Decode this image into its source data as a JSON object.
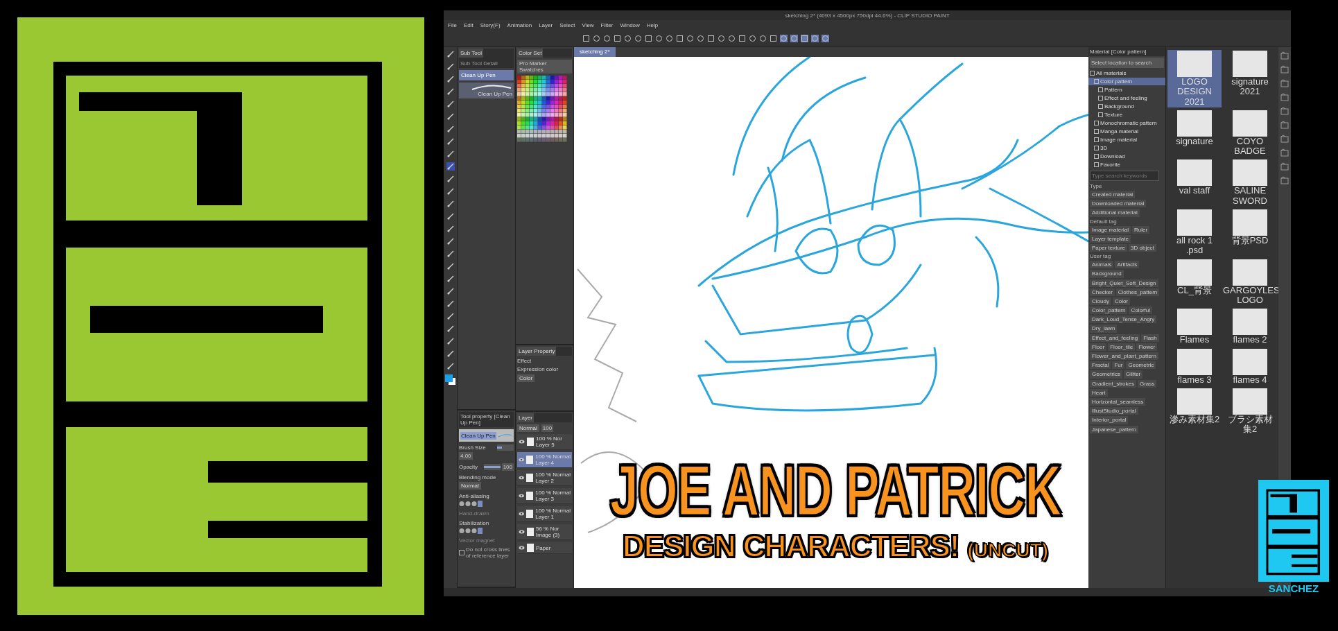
{
  "app": {
    "title": "sketching 2* (4093 x 4500px 750dpi 44.6%) - CLIP STUDIO PAINT",
    "menu": [
      "File",
      "Edit",
      "Story(F)",
      "Animation",
      "Layer",
      "Select",
      "View",
      "Filter",
      "Window",
      "Help"
    ],
    "sub_tool": {
      "tabs": [
        {
          "label": "Sub Tool",
          "selected": true
        },
        {
          "label": "Sub Tool Detail",
          "selected": false
        }
      ],
      "items": [
        {
          "label": "Clean Up Pen",
          "selected": true
        }
      ],
      "preview_label": "Clean Up Pen"
    },
    "color_set": {
      "tab": "Color Set",
      "dropdown": "Pro Marker Swatches"
    },
    "canvas_tab": "sketching 2*",
    "layer_property": {
      "tab": "Layer Property",
      "effect_label": "Effect",
      "expression_label": "Expression color",
      "expression_value": "Color"
    },
    "layers": {
      "tab": "Layer",
      "blend": "Normal",
      "opacity": "100",
      "items": [
        {
          "mode": "100 % Nor",
          "name": "Layer 5",
          "selected": false
        },
        {
          "mode": "100 % Normal",
          "name": "Layer 4",
          "selected": true
        },
        {
          "mode": "100 % Normal",
          "name": "Layer 2",
          "selected": false
        },
        {
          "mode": "100 % Normal",
          "name": "Layer 3",
          "selected": false
        },
        {
          "mode": "100 % Normal",
          "name": "Layer 1",
          "selected": false
        },
        {
          "mode": "56 % Nor",
          "name": "Image (3)",
          "selected": false
        },
        {
          "name": "Paper",
          "selected": false
        }
      ]
    },
    "tool_property": {
      "title": "Tool property [Clean Up Pen]",
      "preview_label": "Clean Up Pen",
      "rows": [
        {
          "kind": "slider",
          "label": "Brush Size",
          "value": "4.00",
          "level": 0.3
        },
        {
          "kind": "slider",
          "label": "Opacity",
          "value": "100",
          "level": 1
        },
        {
          "kind": "dropdown",
          "label": "Blending mode",
          "value": "Normal"
        },
        {
          "kind": "choice",
          "label": "Anti-aliasing"
        },
        {
          "kind": "disabled",
          "label": "Hand-drawn"
        },
        {
          "kind": "choice",
          "label": "Stabilization"
        },
        {
          "kind": "disabled",
          "label": "Vector magnet"
        }
      ],
      "checkbox": {
        "label": "Do not cross lines of reference layer",
        "checked": false
      }
    },
    "materials": {
      "header": "Material [Color pattern]",
      "location": "Select location to search",
      "tree": [
        {
          "label": "All materials",
          "selected": false,
          "children": [
            {
              "label": "Color pattern",
              "selected": true,
              "children": [
                {
                  "label": "Pattern",
                  "selected": false
                },
                {
                  "label": "Effect and feeling",
                  "selected": false
                },
                {
                  "label": "Background",
                  "selected": false
                },
                {
                  "label": "Texture",
                  "selected": false
                }
              ]
            },
            {
              "label": "Monochromatic pattern",
              "selected": false
            },
            {
              "label": "Manga material",
              "selected": false
            },
            {
              "label": "Image material",
              "selected": false
            },
            {
              "label": "3D",
              "selected": false
            },
            {
              "label": "Download",
              "selected": false
            },
            {
              "label": "Favorite",
              "selected": false
            }
          ]
        }
      ],
      "search": {
        "placeholder": "Type search keywords"
      },
      "tag_groups": [
        {
          "title": "Type",
          "tags": [
            "Created material",
            "Downloaded material",
            "Additional material"
          ]
        },
        {
          "title": "Default tag",
          "tags": [
            "Image material",
            "Ruler",
            "Layer template",
            "Paper texture",
            "3D object"
          ]
        },
        {
          "title": "User tag",
          "tags": [
            "Animals",
            "Artifacts",
            "Background",
            "Bright_Quiet_Soft_Design",
            "Checker",
            "Clothes_pattern",
            "Cloudy",
            "Color",
            "Color_pattern",
            "Colorful",
            "Dark_Loud_Tense_Angry",
            "Dry_lawn",
            "Effect_and_feeling",
            "Flash",
            "Floor",
            "Floor_tile",
            "Flower",
            "Flower_and_plant_pattern",
            "Fractal",
            "Fur",
            "Geometric",
            "Geometrics",
            "Glitter",
            "Gradient_strokes",
            "Grass",
            "Heart",
            "Horizontal_seamless",
            "IllustStudio_portal",
            "Interior_portal",
            "Japanese_pattern"
          ]
        }
      ],
      "thumbnails": [
        {
          "label": "LOGO DESIGN 2021",
          "selected": true
        },
        {
          "label": "signature 2021",
          "selected": false
        },
        {
          "label": "signature",
          "selected": false
        },
        {
          "label": "COYO BADGE",
          "selected": false
        },
        {
          "label": "val staff",
          "selected": false
        },
        {
          "label": "SALINE SWORD",
          "selected": false
        },
        {
          "label": "all rock 1 .psd",
          "selected": false
        },
        {
          "label": "背景PSD",
          "selected": false
        },
        {
          "label": "CL_背景",
          "selected": false
        },
        {
          "label": "GARGOYLES LOGO",
          "selected": false
        },
        {
          "label": "Flames",
          "selected": false
        },
        {
          "label": "flames 2",
          "selected": false
        },
        {
          "label": "flames 3",
          "selected": false
        },
        {
          "label": "flames 4",
          "selected": false
        },
        {
          "label": "滲み素材集2",
          "selected": false
        },
        {
          "label": "ブラシ素材集2",
          "selected": false
        }
      ]
    }
  },
  "headline": {
    "line1": "JOE AND PATRICK",
    "line2": "DESIGN CHARACTERS!",
    "note": "(UNCUT)"
  },
  "badge": {
    "label": "SANCHEZ"
  }
}
